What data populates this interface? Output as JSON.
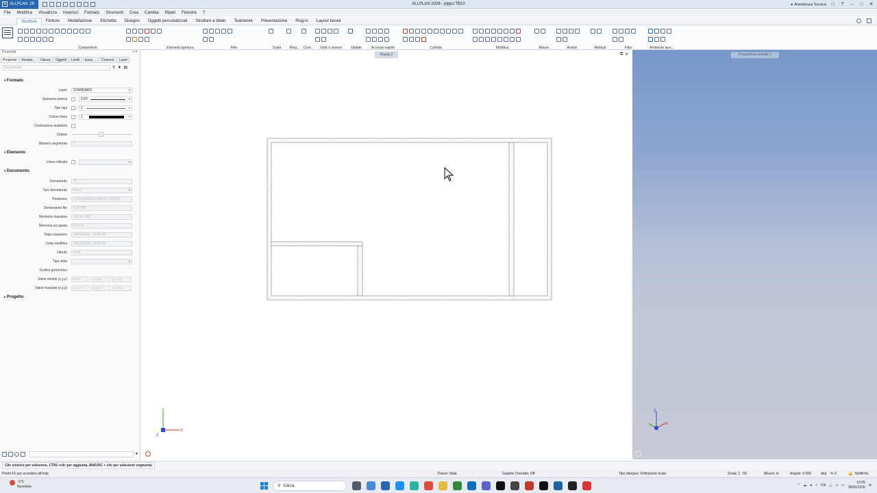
{
  "window": {
    "app_name": "ALLPLAN",
    "app_version": "26",
    "title": "ALLPLAN 2026 - pippo:TB10",
    "assist_label": "Assistenza Tecnica"
  },
  "menu": [
    "File",
    "Modifica",
    "Visualizza",
    "Inserisci",
    "Formato",
    "Strumenti",
    "Crea",
    "Cambia",
    "Ripeti",
    "Finestra",
    "?"
  ],
  "ribbon_tabs": [
    "Strutture",
    "Finiture",
    "Modellazione",
    "Etichetta",
    "Disegno",
    "Oggetti personalizzati",
    "Strutture a telaio",
    "Teamwork",
    "Presentazione",
    "Plug-in",
    "Layout tavola"
  ],
  "ribbon_active_tab": "Strutture",
  "ribbon_groups": [
    "Componenti",
    "Elementi apertura",
    "Tetto",
    "Scala",
    "Ring...",
    "Cont...",
    "Viste e sezioni",
    "Update",
    "Accesso rapido",
    "Cambia",
    "Modifica",
    "Misure",
    "Analisi",
    "Attributi",
    "Filtro",
    "Ambiente lavo..."
  ],
  "views": {
    "plan_tab": "Pianta 2",
    "perspective_label": "Prospettiva centrale 1"
  },
  "panel": {
    "title": "Proprietà",
    "tabs": [
      "Proprietà",
      "Assiste...",
      "Library",
      "Oggetti",
      "Livelli",
      "Issue ...",
      "Connect",
      "Layer"
    ],
    "search_placeholder": "Documento",
    "sections": {
      "formato": "Formato",
      "elemento": "Elemento",
      "documento": "Documento",
      "progetto": "Progetto"
    },
    "formato": {
      "layer_label": "Layer",
      "layer_value": "STANDARD",
      "spessore_label": "Spessore penna",
      "spessore_value": "0.50",
      "tipo_riga_label": "Tipo riga",
      "tipo_riga_value": "1",
      "colore_label": "Colore linea",
      "colore_value": "1",
      "costruzione_label": "Costruzione ausiliaria",
      "ordine_label": "Ordine",
      "ordine_value": "0",
      "numero_label": "Numero segmento",
      "numero_value": "7"
    },
    "elemento": {
      "linea_label": "Linea retinata"
    },
    "documento": {
      "doc_label": "Documento",
      "doc_value": "10",
      "tipo_doc_label": "Tipo documento",
      "tipo_doc_value": "Base",
      "posizione_label": "Posizione",
      "posizione_value": "C:\\Data\\Allplan\\Allplan 2026\\Pr",
      "dim_label": "Dimensione file",
      "dim_value": "4.25 MB",
      "mem_max_label": "Memoria massima",
      "mem_max_value": "469.45 MB",
      "mem_occ_label": "Memoria occupata",
      "mem_occ_value": "0.00 %",
      "data_creaz_label": "Data creazione",
      "data_creaz_value": "28/01/2026, 10:09:08",
      "data_mod_label": "Data modifica",
      "data_mod_value": "28/01/2026, 10:09:08",
      "utente_label": "Utente",
      "utente_value": "local",
      "tipo_vista_label": "Tipo vista",
      "codice_label": "Codice gerarchico",
      "min_label": "Valori minimi (x,y,z)",
      "min_values": [
        "0.0000",
        "0.0000",
        "0.0000"
      ],
      "max_label": "Valori massimi (x,y,z)",
      "max_values": [
        "10.0000",
        "6.0000",
        "0.0000"
      ]
    }
  },
  "status": {
    "message": "Clic sinistro per selezione, CTRL+clic per aggiunta, MAIUSC + clic per selezione segmento",
    "help": "Premi F1 per accedere all'help",
    "paese": "Paese:  Italia",
    "graphic_override": "Graphic Override:  Off",
    "tipo_disegno": "Tipo disegno:  Definizione scala",
    "scala": "Scala:  1 : 50",
    "misure": "Misure:  m",
    "angolo": "Angolo:  0.000",
    "deg": "deg",
    "percent": "%   0",
    "notifiche": "Notifiche"
  },
  "taskbar": {
    "weather_temp": "-1°C",
    "weather_desc": "Nuvoloso",
    "search_placeholder": "Cerca",
    "lang": "ITA",
    "time": "10:09",
    "date": "28/01/2026"
  },
  "colors": {
    "accent": "#2a66b0",
    "sky_top": "#7898c9",
    "sky_bottom": "#c6cad4",
    "axis_x": "#d62828",
    "axis_y": "#2aa82a",
    "axis_z": "#2a4ad6"
  },
  "icons": [
    "windows-start-icon",
    "search-icon",
    "gear-icon",
    "close-icon",
    "minimize-icon",
    "maximize-icon",
    "cursor-icon",
    "funnel-icon"
  ]
}
